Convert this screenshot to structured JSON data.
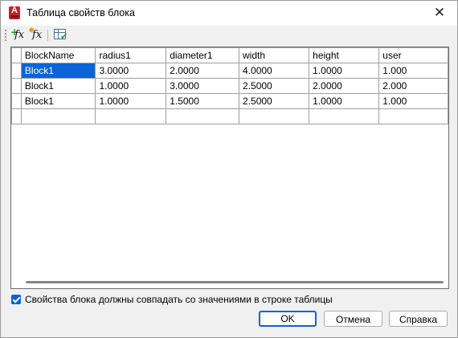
{
  "window": {
    "title": "Таблица свойств блока",
    "close_glyph": "✕"
  },
  "toolbar": {
    "new_fx_label": "fx",
    "new_fx_plus": "+",
    "edit_fx_label": "fx",
    "edit_fx_star": "✸",
    "audit_check": "✔"
  },
  "table": {
    "columns": [
      "BlockName",
      "radius1",
      "diameter1",
      "width",
      "height",
      "user"
    ],
    "rows": [
      [
        "Block1",
        "3.0000",
        "2.0000",
        "4.0000",
        "1.0000",
        "1.000"
      ],
      [
        "Block1",
        "1.0000",
        "3.0000",
        "2.5000",
        "2.0000",
        "2.000"
      ],
      [
        "Block1",
        "1.0000",
        "1.5000",
        "2.5000",
        "1.0000",
        "1.000"
      ]
    ],
    "selected_cell": "Block1"
  },
  "checkbox": {
    "label": "Свойства блока должны совпадать со значениями в строке таблицы",
    "checked": true
  },
  "buttons": {
    "ok": "OK",
    "cancel": "Отмена",
    "help": "Справка"
  }
}
